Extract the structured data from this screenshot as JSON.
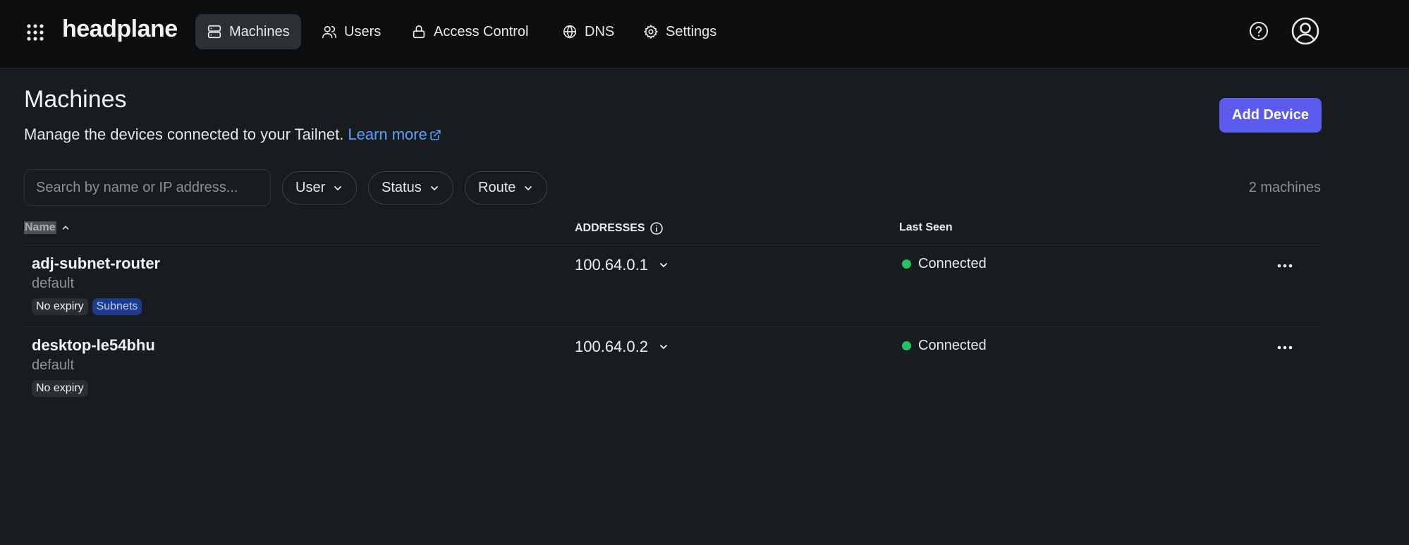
{
  "header": {
    "brand": "headplane",
    "nav": [
      {
        "label": "Machines",
        "icon": "server-icon",
        "active": true
      },
      {
        "label": "Users",
        "icon": "users-icon"
      },
      {
        "label": "Access Control",
        "icon": "lock-icon"
      },
      {
        "label": "DNS",
        "icon": "globe-icon"
      },
      {
        "label": "Settings",
        "icon": "gear-icon"
      }
    ]
  },
  "page": {
    "title": "Machines",
    "description": "Manage the devices connected to your Tailnet.",
    "learn_more": "Learn more",
    "add_button": "Add Device"
  },
  "filters": {
    "search_placeholder": "Search by name or IP address...",
    "user": "User",
    "status": "Status",
    "route": "Route",
    "count": "2 machines"
  },
  "table": {
    "columns": {
      "name": "Name",
      "addresses": "ADDRESSES",
      "last_seen": "Last Seen"
    },
    "rows": [
      {
        "name": "adj-subnet-router",
        "user": "default",
        "tags": [
          "No expiry",
          "Subnets"
        ],
        "address": "100.64.0.1",
        "status": "Connected"
      },
      {
        "name": "desktop-le54bhu",
        "user": "default",
        "tags": [
          "No expiry"
        ],
        "address": "100.64.0.2",
        "status": "Connected"
      }
    ]
  },
  "colors": {
    "accent": "#5b5bf0",
    "link": "#5aa0ff",
    "online": "#22c55e",
    "subnet_tag": "#1e3a8a"
  }
}
